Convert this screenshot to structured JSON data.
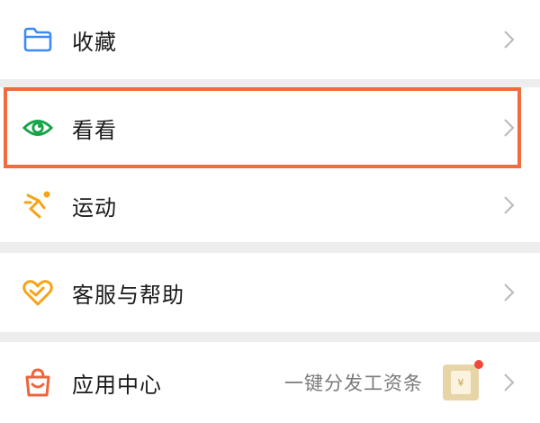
{
  "menu": {
    "items": [
      {
        "label": "收藏",
        "icon": "folder-icon",
        "color": "#3d8af7"
      },
      {
        "label": "看看",
        "icon": "eye-icon",
        "color": "#17a34a"
      },
      {
        "label": "运动",
        "icon": "running-icon",
        "color": "#f7a316"
      },
      {
        "label": "客服与帮助",
        "icon": "heart-icon",
        "color": "#f7a316"
      },
      {
        "label": "应用中心",
        "icon": "shopping-bag-icon",
        "color": "#f0643b",
        "subtext": "一键分发工资条",
        "badge_glyph": "¥"
      }
    ]
  },
  "colors": {
    "highlight": "#f06b3d",
    "background": "#ededed",
    "badge_dot": "#f0483b"
  }
}
